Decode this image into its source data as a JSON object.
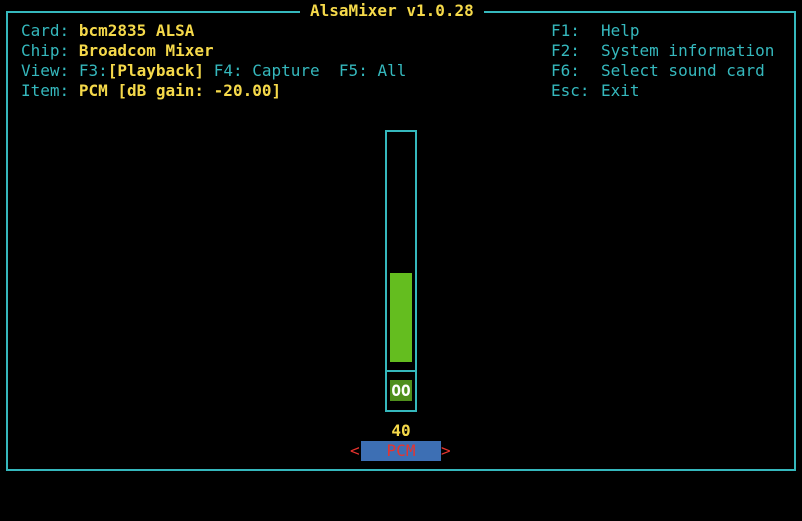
{
  "window": {
    "title": "AlsaMixer v1.0.28"
  },
  "info": {
    "card_label": "Card:",
    "card_value": "bcm2835 ALSA",
    "chip_label": "Chip:",
    "chip_value": "Broadcom Mixer",
    "view_label": "View:",
    "view_f3_key": "F3:",
    "view_f3_value": "[Playback]",
    "view_f4": "F4: Capture",
    "view_f5": "F5: All",
    "item_label": "Item:",
    "item_value": "PCM [dB gain: -20.00]"
  },
  "help": {
    "items": [
      {
        "key": "F1:",
        "label": "Help"
      },
      {
        "key": "F2:",
        "label": "System information"
      },
      {
        "key": "F6:",
        "label": "Select sound card"
      },
      {
        "key": "Esc:",
        "label": "Exit"
      }
    ]
  },
  "control": {
    "name": "PCM",
    "value": "40",
    "volume_fraction": 0.4,
    "mute_indicator": "OO",
    "arrow_left": "<",
    "arrow_right": ">"
  },
  "colors": {
    "border": "#35b8bd",
    "label": "#35b8bd",
    "value": "#f5d94a",
    "volume_bar": "#64bd1f",
    "mute_bg": "#4f8f1c",
    "channel_bg": "#3d6fb4",
    "channel_text": "#e8332e"
  }
}
